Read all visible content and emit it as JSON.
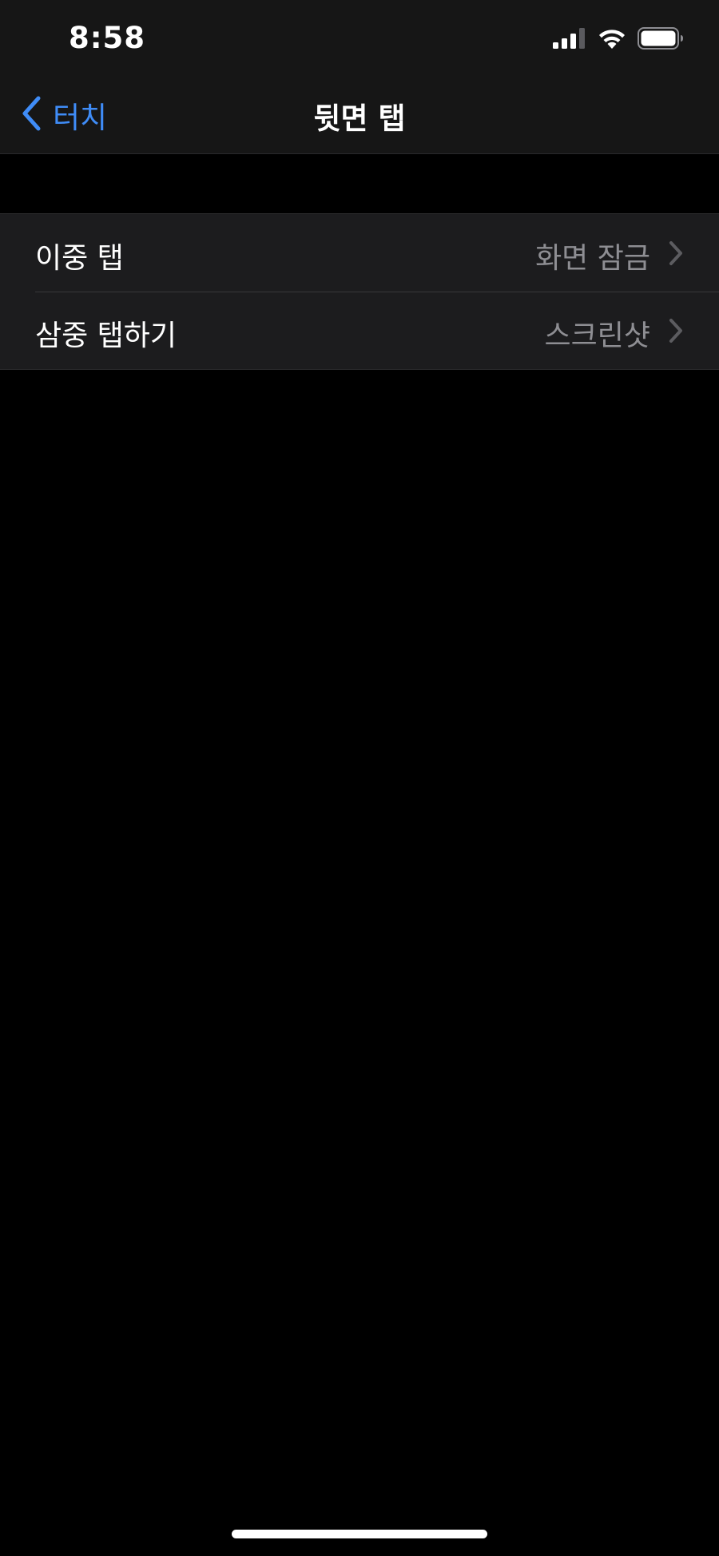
{
  "status_bar": {
    "time": "8:58",
    "signal_icon": "cellular-signal-icon",
    "wifi_icon": "wifi-icon",
    "battery_icon": "battery-icon"
  },
  "nav": {
    "back_label": "터치",
    "back_icon": "chevron-left-icon",
    "title": "뒷면 탭"
  },
  "settings": {
    "rows": [
      {
        "label": "이중 탭",
        "value": "화면 잠금",
        "icon": "chevron-right-icon"
      },
      {
        "label": "삼중 탭하기",
        "value": "스크린샷",
        "icon": "chevron-right-icon"
      }
    ]
  },
  "colors": {
    "accent": "#3f8cf7",
    "background": "#000000",
    "cell_background": "#1c1c1e",
    "secondary_text": "#8e8e93"
  }
}
